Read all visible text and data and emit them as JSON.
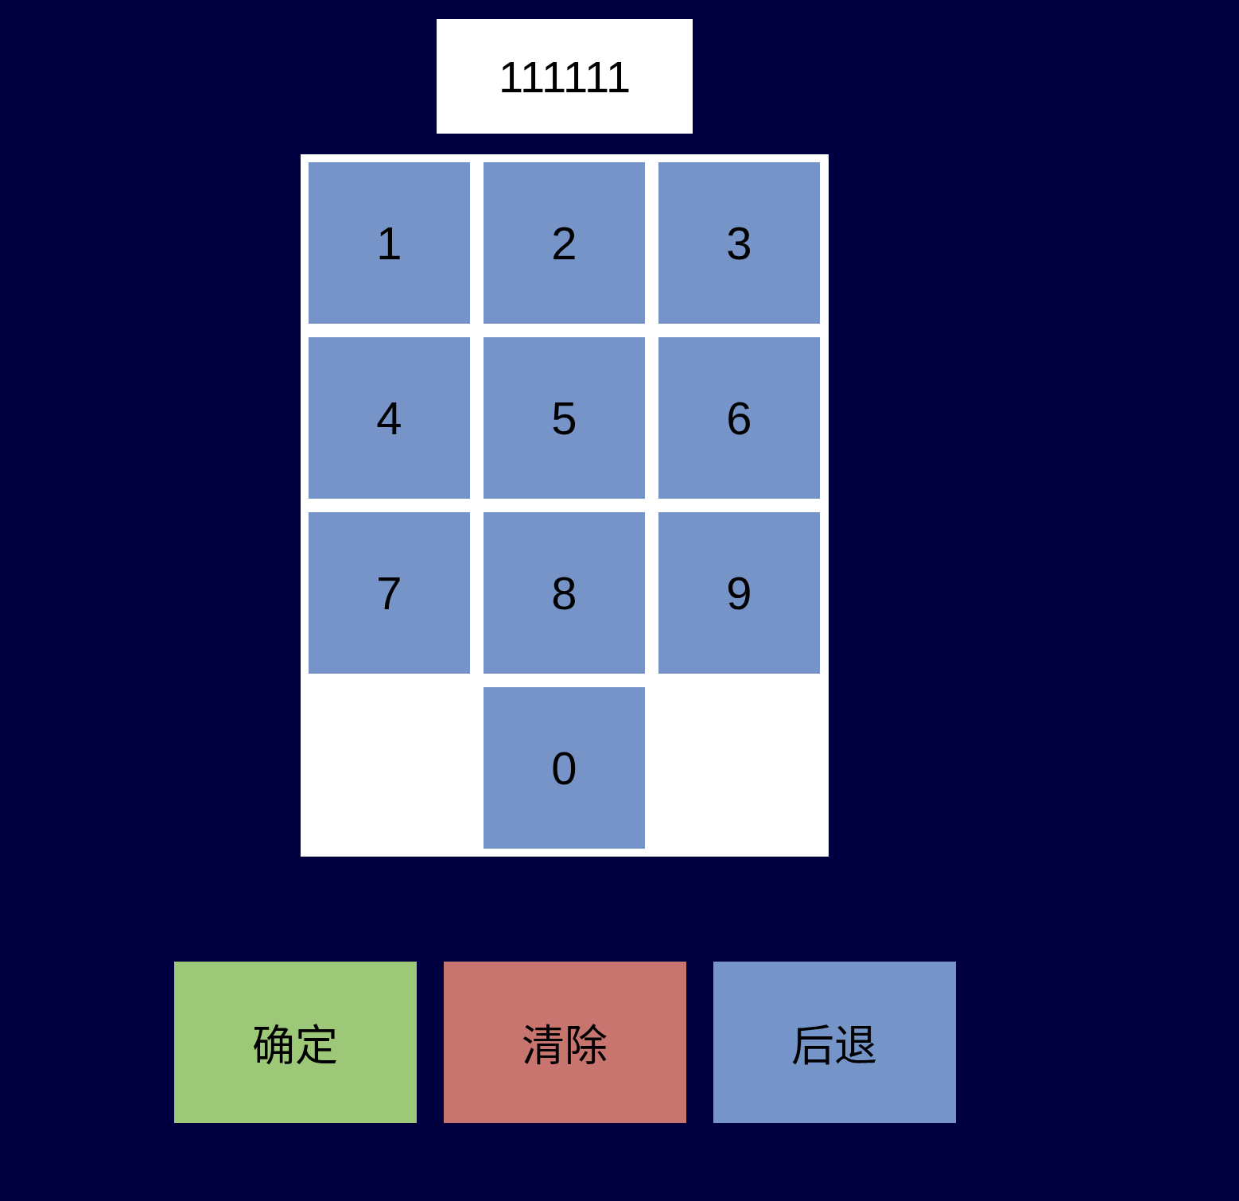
{
  "display": {
    "value": "111111"
  },
  "keypad": {
    "keys": [
      "1",
      "2",
      "3",
      "4",
      "5",
      "6",
      "7",
      "8",
      "9",
      "0"
    ]
  },
  "actions": [
    {
      "label": "确定",
      "color": "#9dc877"
    },
    {
      "label": "清除",
      "color": "#c87570"
    },
    {
      "label": "后退",
      "color": "#7594c8"
    }
  ]
}
